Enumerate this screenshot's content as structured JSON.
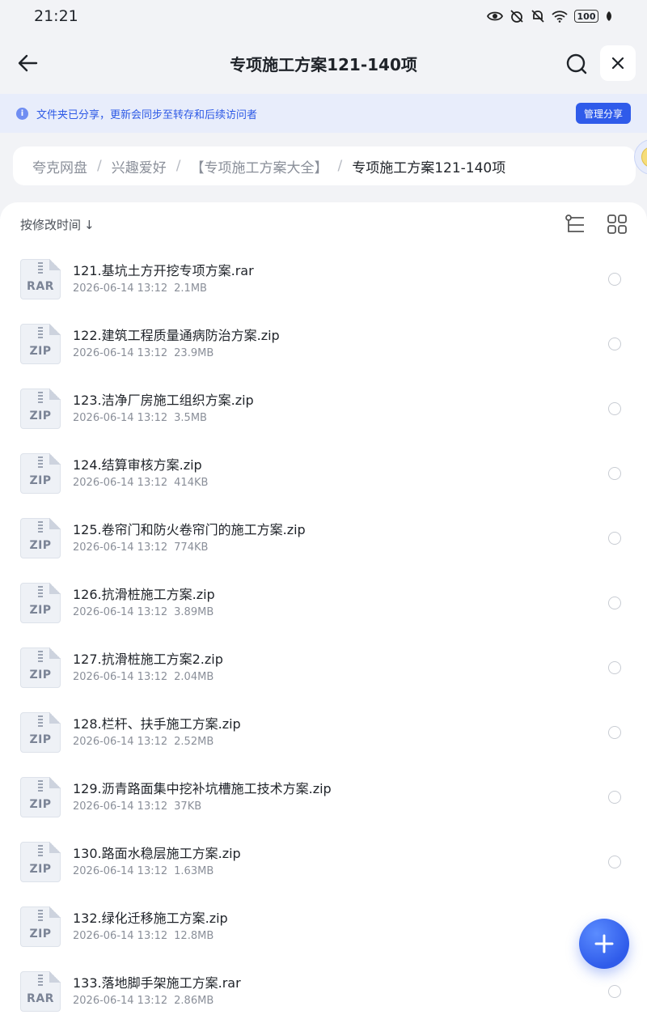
{
  "status_bar": {
    "time": "21:21",
    "battery": "100"
  },
  "header": {
    "title": "专项施工方案121-140项"
  },
  "share_banner": {
    "info_icon": "i",
    "text": "文件夹已分享，更新会同步至转存和后续访问者",
    "button": "管理分享"
  },
  "breadcrumb": {
    "items": [
      "夸克网盘",
      "兴趣爱好",
      "【专项施工方案大全】",
      "专项施工方案121-140项"
    ],
    "separator": "/"
  },
  "toolbar": {
    "sort_label": "按修改时间",
    "sort_arrow": "↓"
  },
  "files": [
    {
      "name": "121.基坑土方开挖专项方案.rar",
      "date": "2026-06-14 13:12",
      "size": "2.1MB",
      "type": "RAR"
    },
    {
      "name": "122.建筑工程质量通病防治方案.zip",
      "date": "2026-06-14 13:12",
      "size": "23.9MB",
      "type": "ZIP"
    },
    {
      "name": "123.洁净厂房施工组织方案.zip",
      "date": "2026-06-14 13:12",
      "size": "3.5MB",
      "type": "ZIP"
    },
    {
      "name": "124.结算审核方案.zip",
      "date": "2026-06-14 13:12",
      "size": "414KB",
      "type": "ZIP"
    },
    {
      "name": "125.卷帘门和防火卷帘门的施工方案.zip",
      "date": "2026-06-14 13:12",
      "size": "774KB",
      "type": "ZIP"
    },
    {
      "name": "126.抗滑桩施工方案.zip",
      "date": "2026-06-14 13:12",
      "size": "3.89MB",
      "type": "ZIP"
    },
    {
      "name": "127.抗滑桩施工方案2.zip",
      "date": "2026-06-14 13:12",
      "size": "2.04MB",
      "type": "ZIP"
    },
    {
      "name": "128.栏杆、扶手施工方案.zip",
      "date": "2026-06-14 13:12",
      "size": "2.52MB",
      "type": "ZIP"
    },
    {
      "name": "129.沥青路面集中挖补坑槽施工技术方案.zip",
      "date": "2026-06-14 13:12",
      "size": "37KB",
      "type": "ZIP"
    },
    {
      "name": "130.路面水稳层施工方案.zip",
      "date": "2026-06-14 13:12",
      "size": "1.63MB",
      "type": "ZIP"
    },
    {
      "name": "132.绿化迁移施工方案.zip",
      "date": "2026-06-14 13:12",
      "size": "12.8MB",
      "type": "ZIP"
    },
    {
      "name": "133.落地脚手架施工方案.rar",
      "date": "2026-06-14 13:12",
      "size": "2.86MB",
      "type": "RAR"
    }
  ],
  "colors": {
    "accent": "#2f5bea",
    "banner_bg": "#e8edfb",
    "page_bg": "#f2f3f6"
  }
}
